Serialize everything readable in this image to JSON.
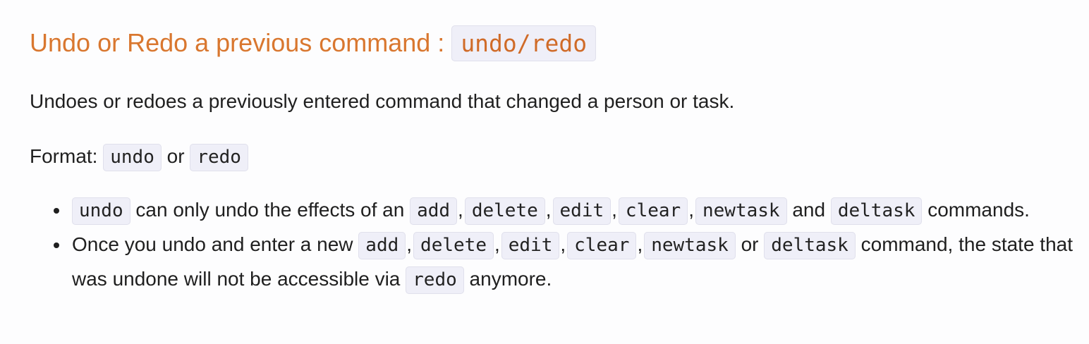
{
  "heading": {
    "text": "Undo or Redo a previous command : ",
    "code": "undo/redo"
  },
  "intro": "Undoes or redoes a previously entered command that changed a person or task.",
  "format": {
    "label": "Format: ",
    "code1": "undo",
    "middle": " or ",
    "code2": "redo"
  },
  "bullets": [
    {
      "code_subject": "undo",
      "text_a": " can only undo the effects of an ",
      "codes": [
        "add",
        "delete",
        "edit",
        "clear",
        "newtask"
      ],
      "joiner": " and ",
      "last_code": "deltask",
      "tail": " commands."
    },
    {
      "text_a": "Once you undo and enter a new ",
      "codes": [
        "add",
        "delete",
        "edit",
        "clear",
        "newtask"
      ],
      "joiner": " or ",
      "last_code": "deltask",
      "tail_a": " command, the state that was undone will not be accessible via ",
      "tail_code": "redo",
      "tail_b": " anymore."
    }
  ],
  "comma": ","
}
